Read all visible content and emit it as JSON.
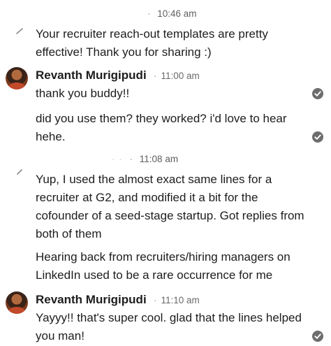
{
  "thread": {
    "block1": {
      "time": "10:46 am",
      "messages": [
        "Your recruiter reach-out templates are pretty effective! Thank you for sharing :)"
      ]
    },
    "block2": {
      "sender": "Revanth Murigipudi",
      "time": "11:00 am",
      "messages": [
        "thank you buddy!!",
        "did you use them? they worked? i'd love to hear hehe."
      ]
    },
    "block3": {
      "time": "11:08 am",
      "messages": [
        "Yup, I used the almost exact same lines for a recruiter at G2, and modified it a bit for the cofounder of a seed-stage startup. Got replies from both of them",
        "Hearing back from recruiters/hiring managers on LinkedIn used to be a rare occurrence for me"
      ]
    },
    "block4": {
      "sender": "Revanth Murigipudi",
      "time": "11:10 am",
      "messages": [
        "Yayyy!! that's super cool. glad that the lines helped you man!"
      ]
    }
  },
  "icons": {
    "read_receipt": "check-circle-icon",
    "edited_marker": "pen-stroke-icon",
    "avatar": "avatar"
  },
  "colors": {
    "text": "#1d1d1d",
    "meta": "#6a6a6a",
    "read_receipt": "#6d6d6d"
  }
}
